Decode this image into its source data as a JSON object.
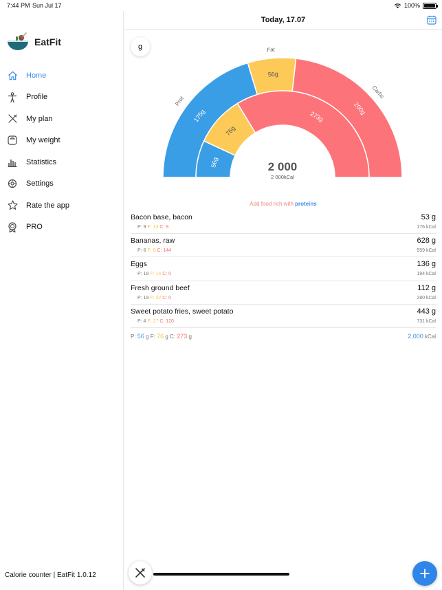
{
  "status": {
    "time": "7:44 PM",
    "date": "Sun Jul 17",
    "battery": "100%",
    "battery_level": 1.0
  },
  "app": {
    "name": "EatFit",
    "footer": "Calorie counter | EatFit 1.0.12"
  },
  "nav": [
    {
      "label": "Home",
      "icon": "home-icon",
      "active": true
    },
    {
      "label": "Profile",
      "icon": "person-icon"
    },
    {
      "label": "My plan",
      "icon": "utensils-icon"
    },
    {
      "label": "My weight",
      "icon": "scale-icon"
    },
    {
      "label": "Statistics",
      "icon": "bar-chart-icon"
    },
    {
      "label": "Settings",
      "icon": "gear-icon"
    },
    {
      "label": "Rate the app",
      "icon": "star-icon"
    },
    {
      "label": "PRO",
      "icon": "award-icon"
    }
  ],
  "header": {
    "title": "Today, 17.07"
  },
  "unit_toggle": "g",
  "colors": {
    "protein": "#3a9ee6",
    "fat": "#fdc957",
    "carbs": "#fc7479",
    "accent": "#3a8ee6"
  },
  "chart_data": {
    "type": "donut-gauge",
    "outer_ring": {
      "series": [
        {
          "name": "Prot",
          "label": "175g",
          "value": 175
        },
        {
          "name": "Fat",
          "label": "56g",
          "value": 56
        },
        {
          "name": "Carbs",
          "label": "200g",
          "value": 200
        }
      ]
    },
    "inner_ring": {
      "series": [
        {
          "label": "56g",
          "value": 56
        },
        {
          "label": "76g",
          "value": 76
        },
        {
          "label": "273g",
          "value": 273
        }
      ]
    },
    "center_value": "2 000",
    "center_sub": "2 000kCal"
  },
  "hint": {
    "text": "Add food rich with",
    "emphasis": "proteins"
  },
  "foods": [
    {
      "name": "Bacon base, bacon",
      "weight": "53 g",
      "p": "P: 9",
      "f": "F: 13",
      "c": "C: 9",
      "kcal": "176 kCal"
    },
    {
      "name": "Bananas, raw",
      "weight": "628 g",
      "p": "P: 6",
      "f": "F: 0",
      "c": "C: 144",
      "kcal": "559 kCal"
    },
    {
      "name": "Eggs",
      "weight": "136 g",
      "p": "P: 18",
      "f": "F: 14",
      "c": "C: 0",
      "kcal": "194 kCal"
    },
    {
      "name": "Fresh ground beef",
      "weight": "112 g",
      "p": "P: 19",
      "f": "F: 22",
      "c": "C: 0",
      "kcal": "280 kCal"
    },
    {
      "name": "Sweet potato fries, sweet potato",
      "weight": "443 g",
      "p": "P: 4",
      "f": "F: 27",
      "c": "C: 120",
      "kcal": "731 kCal"
    }
  ],
  "totals": {
    "p_label": "P:",
    "p_value": "56",
    "f_label": "F:",
    "f_value": "76",
    "c_label": "C:",
    "c_value": "273",
    "unit": "g",
    "kcal_value": "2,000",
    "kcal_unit": "kCal"
  }
}
